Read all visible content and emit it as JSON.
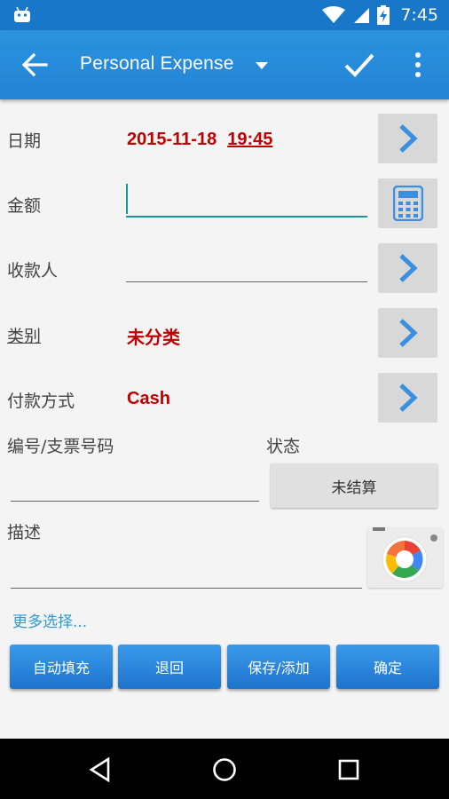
{
  "status_bar": {
    "time": "7:45"
  },
  "app_bar": {
    "title": "Personal Expense"
  },
  "form": {
    "date": {
      "label": "日期",
      "date": "2015-11-18",
      "time": "19:45"
    },
    "amount": {
      "label": "金额",
      "value": ""
    },
    "payee": {
      "label": "收款人",
      "value": ""
    },
    "category": {
      "label": "类别",
      "value": "未分类"
    },
    "payment_method": {
      "label": "付款方式",
      "value": "Cash"
    },
    "number": {
      "label": "编号/支票号码",
      "value": ""
    },
    "status": {
      "label": "状态",
      "value": "未结算"
    },
    "description": {
      "label": "描述",
      "value": ""
    },
    "more_options": "更多选择..."
  },
  "buttons": {
    "autofill": "自动填充",
    "back": "退回",
    "save_add": "保存/添加",
    "confirm": "确定"
  },
  "colors": {
    "app_bar": "#2383d4",
    "status_bar": "#1877c8",
    "value_red": "#c00000",
    "accent_teal": "#129a9a",
    "link_blue": "#2a9ad4"
  }
}
